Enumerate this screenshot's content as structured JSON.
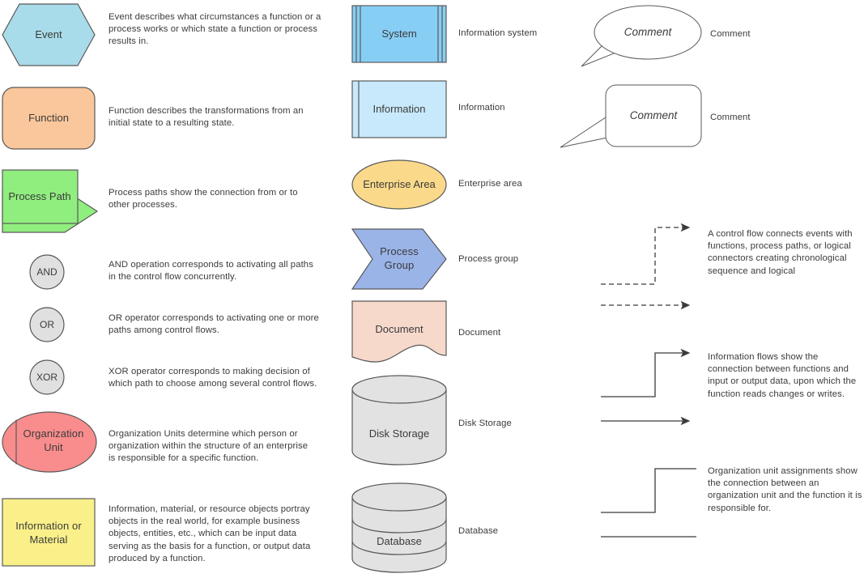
{
  "colors": {
    "event_fill": "#a9dcea",
    "function_fill": "#fac69b",
    "process_path_fill": "#90ee7e",
    "connector_fill": "#e0e0e0",
    "org_unit_fill": "#f98d8d",
    "info_material_fill": "#faf08a",
    "system_fill": "#87cef5",
    "information_fill": "#c8e9fb",
    "enterprise_fill": "#fad98a",
    "process_group_fill": "#9ab4e8",
    "document_fill": "#f7d9cc",
    "storage_fill": "#e2e2e2",
    "stroke": "#595959",
    "text": "#3b3b3b"
  },
  "left_column": [
    {
      "id": "event",
      "shape": "hexagon",
      "shape_label": "Event",
      "description": "Event describes what circumstances a function or a\n process works or which state a function or process\n results in."
    },
    {
      "id": "function",
      "shape": "rounded-rect",
      "shape_label": "Function",
      "description": "Function describes the transformations from an\ninitial state to a resulting state."
    },
    {
      "id": "process-path",
      "shape": "chevron-with-rect",
      "shape_label": "Process Path",
      "description": "Process paths show the connection from or to\nother processes."
    },
    {
      "id": "and",
      "shape": "circle",
      "shape_label": "AND",
      "description": "AND operation corresponds to activating all paths\nin the control flow concurrently."
    },
    {
      "id": "or",
      "shape": "circle",
      "shape_label": "OR",
      "description": "OR operator corresponds to activating one or more\n paths among control flows."
    },
    {
      "id": "xor",
      "shape": "circle",
      "shape_label": "XOR",
      "description": "XOR operator corresponds to making decision of\nwhich path to choose among several control flows."
    },
    {
      "id": "organization-unit",
      "shape": "ellipse-with-bar",
      "shape_label": "Organization\nUnit",
      "description": "Organization Units determine which person or\norganization within the structure of an enterprise\nis responsible for a specific function."
    },
    {
      "id": "information-or-material",
      "shape": "rect",
      "shape_label": "Information or\nMaterial",
      "description": "Information, material, or resource objects portray\nobjects in the real world, for example business\nobjects, entities, etc., which can be input data\nserving as the basis for a function, or output data\nproduced by a function."
    }
  ],
  "middle_column": [
    {
      "id": "system",
      "shape": "system-rect",
      "shape_label": "System",
      "label": "Information system"
    },
    {
      "id": "information",
      "shape": "information-rect",
      "shape_label": "Information",
      "label": "Information"
    },
    {
      "id": "enterprise-area",
      "shape": "ellipse",
      "shape_label": "Enterprise Area",
      "label": "Enterprise area"
    },
    {
      "id": "process-group",
      "shape": "chevron",
      "shape_label": "Process\nGroup",
      "label": "Process group"
    },
    {
      "id": "document",
      "shape": "document",
      "shape_label": "Document",
      "label": "Document"
    },
    {
      "id": "disk-storage",
      "shape": "cylinder",
      "shape_label": "Disk Storage",
      "label": "Disk Storage"
    },
    {
      "id": "database",
      "shape": "cylinder-banded",
      "shape_label": "Database",
      "label": "Database"
    }
  ],
  "right_column": [
    {
      "id": "comment-oval",
      "shape": "callout-oval",
      "shape_label": "Comment",
      "label": "Comment"
    },
    {
      "id": "comment-rounded",
      "shape": "callout-rounded",
      "shape_label": "Comment",
      "label": "Comment"
    },
    {
      "id": "control-flow",
      "shape": "dashed-arrows",
      "description": "A control flow connects events with\nfunctions, process paths, or logical\nconnectors creating chronological\nsequence and logical"
    },
    {
      "id": "information-flow",
      "shape": "solid-arrows",
      "description": "Information flows show the\nconnection between functions and\ninput or output data, upon which the\nfunction reads changes or writes."
    },
    {
      "id": "organization-assignment",
      "shape": "plain-lines",
      "description": "Organization unit assignments show\nthe connection between an\norganization unit and the function it is\n responsible for."
    }
  ]
}
